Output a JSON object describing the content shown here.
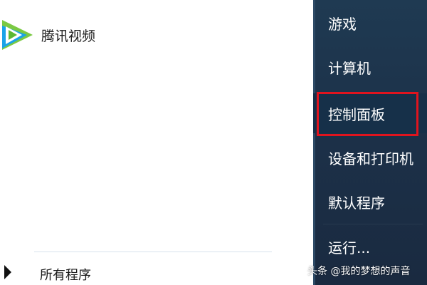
{
  "left_pane": {
    "pinned_programs": [
      {
        "label": "腾讯视频",
        "icon": "tencent-video-icon"
      }
    ],
    "all_programs_label": "所有程序"
  },
  "right_pane": {
    "items": [
      {
        "label": "游戏"
      },
      {
        "label": "计算机"
      },
      {
        "label": "控制面板"
      },
      {
        "label": "设备和打印机"
      },
      {
        "label": "默认程序"
      },
      {
        "label": "运行..."
      }
    ],
    "highlighted_item": "控制面板"
  },
  "annotation": {
    "color": "#e0141e"
  },
  "watermark": {
    "text": "头条 @我的梦想的声音"
  },
  "colors": {
    "sidebar": "#1c3149",
    "accent_green": "#4fc43a",
    "accent_blue": "#1aa3e8"
  }
}
